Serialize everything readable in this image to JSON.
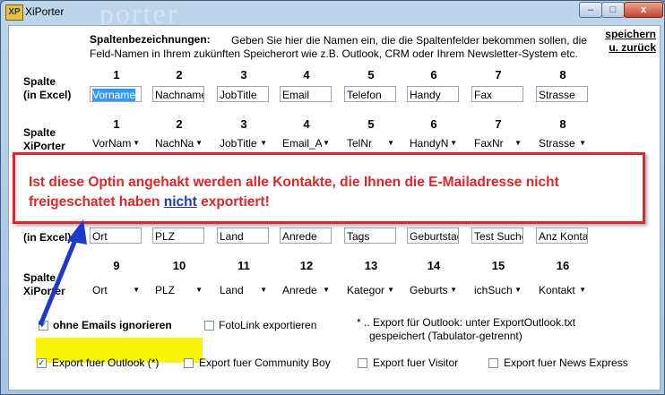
{
  "window": {
    "title": "XiPorter",
    "logo": "XP",
    "watermark": "porter",
    "min_symbol": "–",
    "max_symbol": "□",
    "close_symbol": "x"
  },
  "header": {
    "bold_label": "Spaltenbezeichnungen:",
    "desc_line1": "Geben Sie hier die Namen ein, die die Spaltenfelder bekommen sollen, die",
    "desc_line2": "Feld-Namen in Ihrem zukünften Speicherort wie z.B. Outlook, CRM oder Ihrem Newsletter-System etc.",
    "save_line1": "speichern",
    "save_line2": "u.  zurück"
  },
  "labels": {
    "excel_1": "Spalte",
    "excel_2": "(in Excel)",
    "xi_1": "Spalte",
    "xi_2": "XiPorter",
    "excel_b": "(in Excel)",
    "xi_b1": "Spalte",
    "xi_b2": "XiPorter"
  },
  "row1": {
    "numbers": [
      "1",
      "2",
      "3",
      "4",
      "5",
      "6",
      "7",
      "8"
    ],
    "excel_fields": [
      "Vorname",
      "Nachname",
      "JobTitle",
      "Email",
      "Telefon",
      "Handy",
      "Fax",
      "Strasse"
    ],
    "xiporter_selects": [
      "VorNam",
      "NachNa",
      "JobTitle",
      "Email_A",
      "TelNr",
      "HandyN",
      "FaxNr",
      "Strasse"
    ]
  },
  "row2": {
    "excel_fields": [
      "Ort",
      "PLZ",
      "Land",
      "Anrede",
      "Tags",
      "Geburtstag",
      "Test Suche",
      "Anz Kontakt"
    ],
    "numbers": [
      "9",
      "10",
      "11",
      "12",
      "13",
      "14",
      "15",
      "16"
    ],
    "xiporter_selects": [
      "Ort",
      "PLZ",
      "Land",
      "Anrede",
      "Kategor",
      "Geburts",
      "ichSuch",
      "Kontakt"
    ]
  },
  "options": {
    "ignore_label": "ohne Emails ignorieren",
    "fotolink_label": "FotoLink exportieren",
    "note_line1": "* .. Export für Outlook: unter ExportOutlook.txt",
    "note_line2": "gespeichert (Tabulator-getrennt)",
    "outlook_label": "Export fuer Outlook (*)",
    "community_label": "Export fuer Community Boy",
    "visitor_label": "Export fuer Visitor",
    "news_label": "Export fuer News Express"
  },
  "overlay": {
    "line1": "Ist diese Optin angehakt werden alle Kontakte, die Ihnen die E-Mailadresse nicht",
    "line2_start": "freigeschatet haben ",
    "line2_link": "nicht",
    "line2_end": " exportiert!"
  },
  "colors": {
    "annotation_red": "#e0262a",
    "arrow_blue": "#1c39c9",
    "highlight_yellow": "#f7f30a"
  }
}
